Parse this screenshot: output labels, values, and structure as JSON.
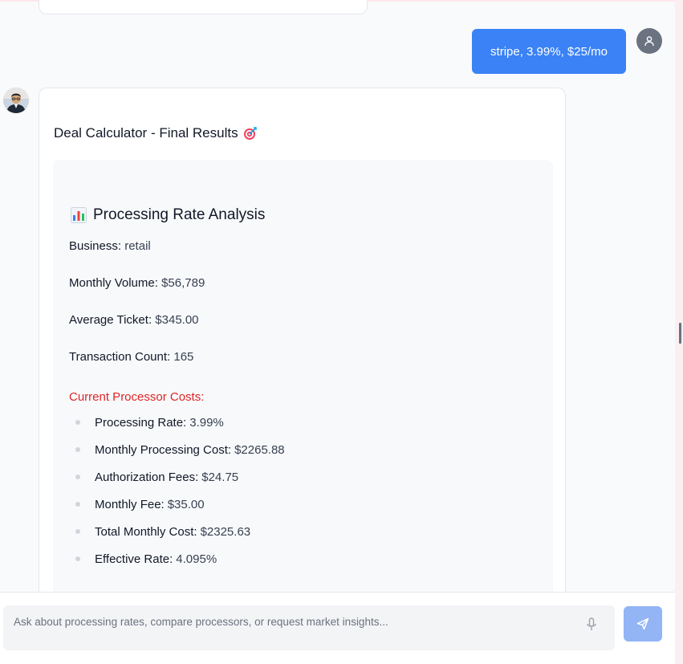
{
  "chat": {
    "user_message": "stripe, 3.99%, $25/mo"
  },
  "bot": {
    "title": "Deal Calculator - Final Results",
    "title_icon": "target-emoji",
    "analysis": {
      "heading": "Processing Rate Analysis",
      "heading_icon": "bar-chart-emoji",
      "business_label": "Business:",
      "business_value": "retail",
      "volume_label": "Monthly Volume:",
      "volume_value": "$56,789",
      "ticket_label": "Average Ticket:",
      "ticket_value": "$345.00",
      "count_label": "Transaction Count:",
      "count_value": "165",
      "costs_heading": "Current Processor Costs:",
      "costs": [
        {
          "label": "Processing Rate:",
          "value": "3.99%"
        },
        {
          "label": "Monthly Processing Cost:",
          "value": "$2265.88"
        },
        {
          "label": "Authorization Fees:",
          "value": "$24.75"
        },
        {
          "label": "Monthly Fee:",
          "value": "$35.00"
        },
        {
          "label": "Total Monthly Cost:",
          "value": "$2325.63"
        },
        {
          "label": "Effective Rate:",
          "value": "4.095%"
        }
      ]
    }
  },
  "composer": {
    "placeholder": "Ask about processing rates, compare processors, or request market insights...",
    "mic_icon": "microphone-icon",
    "send_icon": "send-icon"
  },
  "colors": {
    "accent": "#3b82f6",
    "send_disabled": "#93b4f5",
    "warning_text": "#dc2626"
  }
}
